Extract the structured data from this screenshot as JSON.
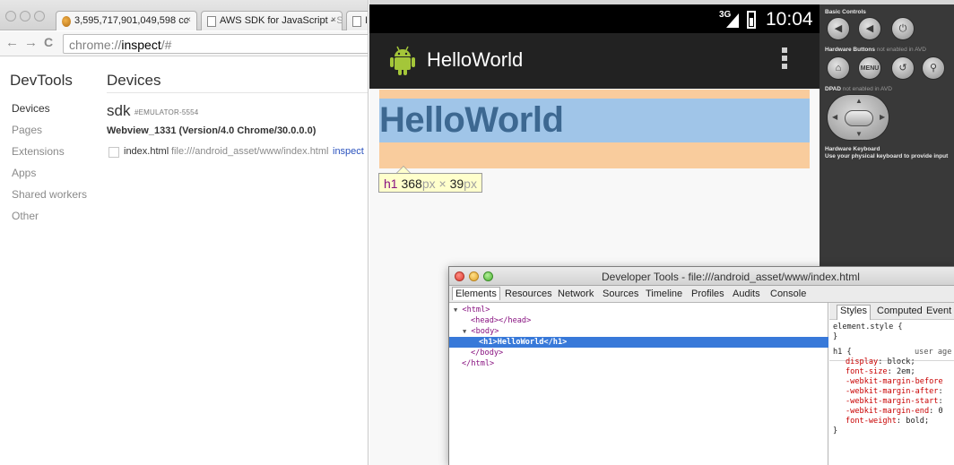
{
  "chrome": {
    "tabs": [
      {
        "title": "3,595,717,901,049,598 cc",
        "icon": "orange-favicon-icon"
      },
      {
        "title": "AWS SDK for JavaScript -",
        "title_fade": "S",
        "icon": "page-icon"
      },
      {
        "title": "In",
        "icon": "page-icon"
      }
    ],
    "tab_close": "×",
    "nav": {
      "back": "←",
      "forward": "→",
      "reload": "C"
    },
    "omnibox": {
      "scheme": "chrome://",
      "host": "inspect",
      "rest": "/#"
    },
    "sidebar": {
      "title": "DevTools",
      "items": [
        {
          "label": "Devices"
        },
        {
          "label": "Pages"
        },
        {
          "label": "Extensions"
        },
        {
          "label": "Apps"
        },
        {
          "label": "Shared workers"
        },
        {
          "label": "Other"
        }
      ]
    },
    "devices": {
      "title": "Devices",
      "device_name": "sdk",
      "device_serial": "#EMULATOR-5554",
      "webview": "Webview_1331 (Version/4.0 Chrome/30.0.0.0)",
      "page": {
        "title": "index.html",
        "url": "file:///android_asset/www/index.html",
        "inspect_label": "inspect"
      }
    }
  },
  "emulator": {
    "status": {
      "network": "3G",
      "time": "10:04"
    },
    "app_title": "HelloWorld",
    "heading_text": "HelloWorld",
    "tooltip": {
      "tag": "h1",
      "width": "368",
      "unit1": "px",
      "times": " × ",
      "height": "39",
      "unit2": "px"
    },
    "controls": {
      "basic_label": "Basic Controls",
      "hw_label": "Hardware Buttons",
      "hw_note": " not enabled in AVD",
      "dpad_label": "DPAD",
      "dpad_note": " not enabled in AVD",
      "kb_label": "Hardware Keyboard",
      "kb_note": "Use your physical keyboard to provide input",
      "menu_label": "MENU"
    }
  },
  "devtools": {
    "title": "Developer Tools - file:///android_asset/www/index.html",
    "tabs": [
      {
        "label": "Elements"
      },
      {
        "label": "Resources"
      },
      {
        "label": "Network"
      },
      {
        "label": "Sources"
      },
      {
        "label": "Timeline"
      },
      {
        "label": "Profiles"
      },
      {
        "label": "Audits"
      },
      {
        "label": "Console"
      }
    ],
    "dom": [
      {
        "text": "<html>",
        "tri": "▼"
      },
      {
        "text": "<head></head>",
        "tri": ""
      },
      {
        "text": "<body>",
        "tri": "▼"
      },
      {
        "text": "<h1>HelloWorld</h1>",
        "tri": ""
      },
      {
        "text": "</body>",
        "tri": ""
      },
      {
        "text": "</html>",
        "tri": ""
      }
    ],
    "styles": {
      "tabs": [
        {
          "label": "Styles"
        },
        {
          "label": "Computed"
        },
        {
          "label": "Event L"
        }
      ],
      "element_style": "element.style {",
      "close_brace": "}",
      "rule_selector": "h1 {",
      "rule_origin": "user age",
      "props": [
        {
          "name": "display",
          "value": "block;"
        },
        {
          "name": "font-size",
          "value": "2em;"
        },
        {
          "name": "-webkit-margin-before",
          "value": ""
        },
        {
          "name": "-webkit-margin-after",
          "value": ""
        },
        {
          "name": "-webkit-margin-start",
          "value": ""
        },
        {
          "name": "-webkit-margin-end",
          "value": "0"
        },
        {
          "name": "font-weight",
          "value": "bold;"
        }
      ]
    }
  }
}
